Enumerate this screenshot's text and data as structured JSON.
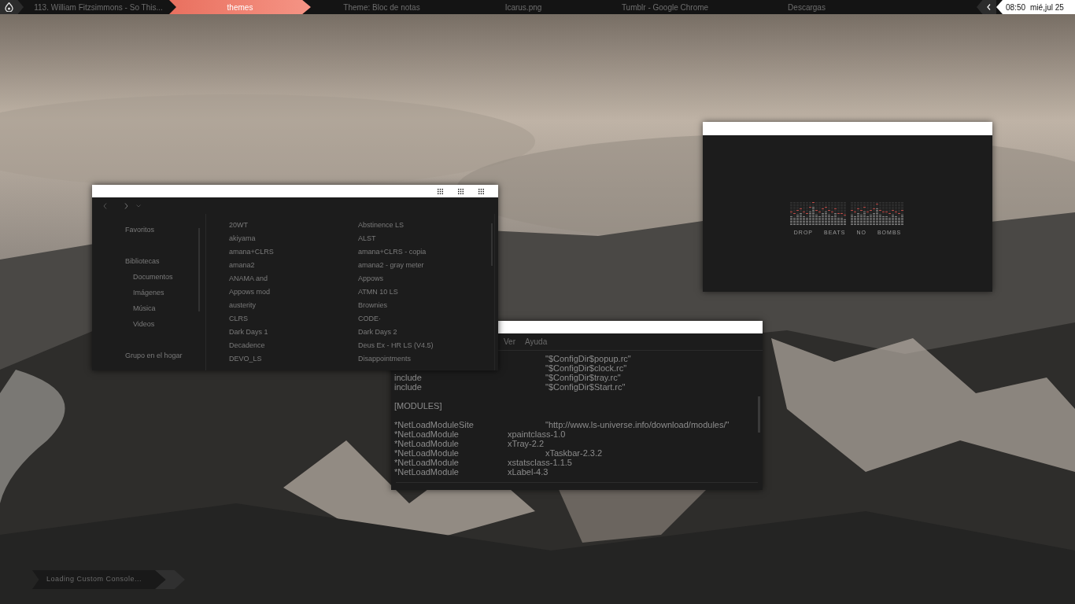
{
  "taskbar": {
    "tasks": [
      {
        "label": "113. William Fitzsimmons - So This...",
        "selected": false
      },
      {
        "label": "themes",
        "selected": true
      },
      {
        "label": "Theme: Bloc de notas",
        "selected": false
      },
      {
        "label": "Icarus.png",
        "selected": false
      },
      {
        "label": "Tumblr - Google Chrome",
        "selected": false
      },
      {
        "label": "Descargas",
        "selected": false
      }
    ],
    "clock": {
      "time": "08:50",
      "date": "mié,jul 25"
    }
  },
  "explorer": {
    "sidebar": [
      {
        "label": "Favoritos"
      },
      {
        "label": "Bibliotecas",
        "children": [
          {
            "label": "Documentos"
          },
          {
            "label": "Imágenes"
          },
          {
            "label": "Música"
          },
          {
            "label": "Videos"
          }
        ]
      },
      {
        "label": "Grupo en el hogar"
      }
    ],
    "columns": [
      [
        "20WT",
        "akiyama",
        "amana+CLRS",
        "amana2",
        "ANAMA and",
        "Appows mod",
        "austerity",
        "CLRS",
        "Dark Days 1",
        "Decadence",
        "DEVO_LS"
      ],
      [
        "Abstinence LS",
        "ALST",
        "amana+CLRS - copia",
        "amana2 - gray meter",
        "Appows",
        "ATMN 10 LS",
        "Brownies",
        "CODE·",
        "Dark Days 2",
        "Deus Ex - HR LS (V4.5)",
        "Disappointments"
      ]
    ]
  },
  "notepad": {
    "menu": [
      "Ver",
      "Ayuda"
    ],
    "lines": [
      {
        "kind": "code",
        "text": "\t\t\t\t\"$ConfigDir$popup.rc\""
      },
      {
        "kind": "code",
        "text": "\t\t\t\t\"$ConfigDir$clock.rc\""
      },
      {
        "kind": "code",
        "text": "include\t\t\t\t\"$ConfigDir$tray.rc\""
      },
      {
        "kind": "code",
        "text": "include\t\t\t\t\"$ConfigDir$Start.rc\""
      },
      {
        "kind": "blank"
      },
      {
        "kind": "code",
        "text": "[MODULES]"
      },
      {
        "kind": "blank"
      },
      {
        "kind": "code",
        "text": "*NetLoadModuleSite\t\t\"http://www.ls-universe.info/download/modules/\""
      },
      {
        "kind": "code",
        "text": "*NetLoadModule\t\txpaintclass-1.0"
      },
      {
        "kind": "code",
        "text": "*NetLoadModule\t\txTray-2.2"
      },
      {
        "kind": "code",
        "text": "*NetLoadModule\t\t\txTaskbar-2.3.2"
      },
      {
        "kind": "code",
        "text": "*NetLoadModule\t\txstatsclass-1.1.5"
      },
      {
        "kind": "code",
        "text": "*NetLoadModule\t\txLabel-4.3"
      }
    ]
  },
  "visualizer": {
    "labels": [
      "DROP",
      "BEATS",
      "NO",
      "BOMBS"
    ]
  },
  "console": {
    "text": "Loading Custom Console..."
  }
}
